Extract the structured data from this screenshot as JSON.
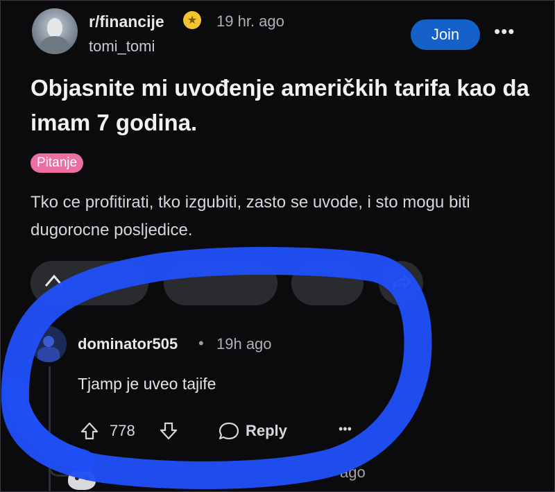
{
  "post": {
    "subreddit": "r/financije",
    "time": "19 hr. ago",
    "username": "tomi_tomi",
    "join_label": "Join",
    "more_label": "•••",
    "title": "Objasnite mi uvođenje američkih tarifa kao da imam 7 godina.",
    "flair": "Pitanje",
    "body": "Tko ce profitirati, tko izgubiti, zasto se uvode, i sto mogu biti dugorocne posljedice."
  },
  "comment": {
    "username": "dominator505",
    "separator": "•",
    "time": "19h ago",
    "text": "Tjamp je uveo tajife",
    "votes": "778",
    "reply_label": "Reply",
    "more_label": "•••"
  },
  "partial": {
    "next_time": "ago"
  },
  "icons": {
    "subreddit_badge": "star-badge-icon",
    "share": "share-icon",
    "upvote": "upvote-arrow-icon",
    "downvote": "downvote-arrow-icon",
    "reply": "reply-bubble-icon"
  },
  "colors": {
    "background": "#0b0b0d",
    "join_button": "#1560c9",
    "flair": "#ec6fa3",
    "badge": "#f4c430",
    "marker_circle": "#1f4ef5"
  }
}
